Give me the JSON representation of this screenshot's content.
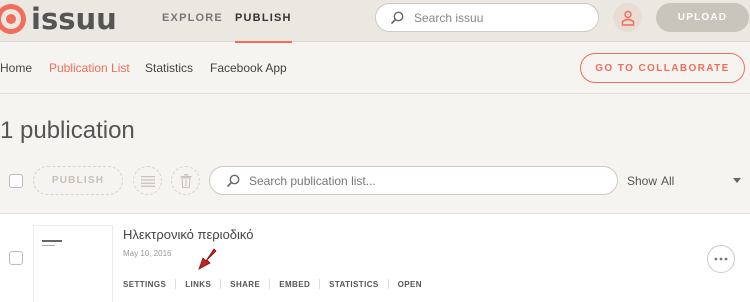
{
  "header": {
    "logo_text": "issuu",
    "nav": {
      "explore": "EXPLORE",
      "publish": "PUBLISH"
    },
    "search_placeholder": "Search issuu",
    "upload_label": "UPLOAD",
    "accent_color": "#f36d5a"
  },
  "subnav": {
    "items": [
      {
        "label": "Home"
      },
      {
        "label": "Publication List"
      },
      {
        "label": "Statistics"
      },
      {
        "label": "Facebook App"
      }
    ],
    "active": "Publication List",
    "collaborate_label": "GO TO COLLABORATE"
  },
  "main": {
    "title": "1 publication",
    "toolbar": {
      "publish_label": "PUBLISH",
      "search_placeholder": "Search publication list...",
      "show_label": "Show",
      "show_value": "All"
    },
    "publications": [
      {
        "title": "Ηλεκτρονικό περιοδικό",
        "date": "May 10, 2016",
        "actions": [
          "SETTINGS",
          "LINKS",
          "SHARE",
          "EMBED",
          "STATISTICS",
          "OPEN"
        ]
      }
    ]
  },
  "icons": [
    "search-icon",
    "user-icon",
    "list-icon",
    "trash-icon",
    "more-icon",
    "annotation-arrow"
  ]
}
